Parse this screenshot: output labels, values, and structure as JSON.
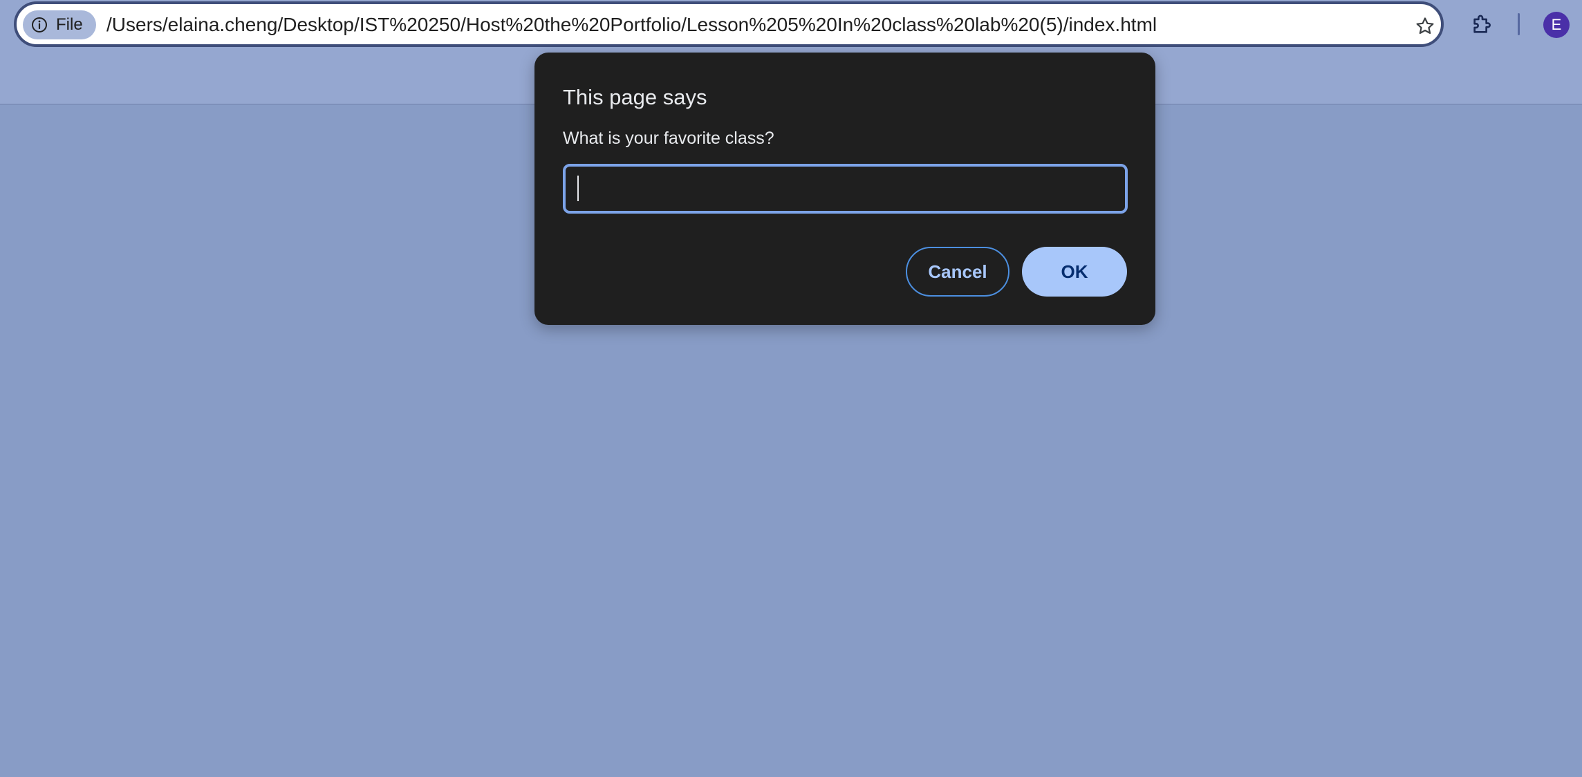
{
  "browser": {
    "site_info_chip": {
      "icon": "info-icon",
      "label": "File"
    },
    "address": "/Users/elaina.cheng/Desktop/IST%20250/Host%20the%20Portfolio/Lesson%205%20In%20class%20lab%20(5)/index.html",
    "bookmark_icon": "star-icon",
    "extensions_icon": "puzzle-icon",
    "profile_initial": "E"
  },
  "dialog": {
    "title": "This page says",
    "message": "What is your favorite class?",
    "input_value": "",
    "cancel_label": "Cancel",
    "ok_label": "OK"
  },
  "colors": {
    "page_background": "#889CC6",
    "toolbar_background": "#95A7D0",
    "dialog_background": "#1F1F1F",
    "input_focus_border": "#7CA3E8",
    "ok_button": "#A8C7FA",
    "avatar": "#4A30A8"
  }
}
